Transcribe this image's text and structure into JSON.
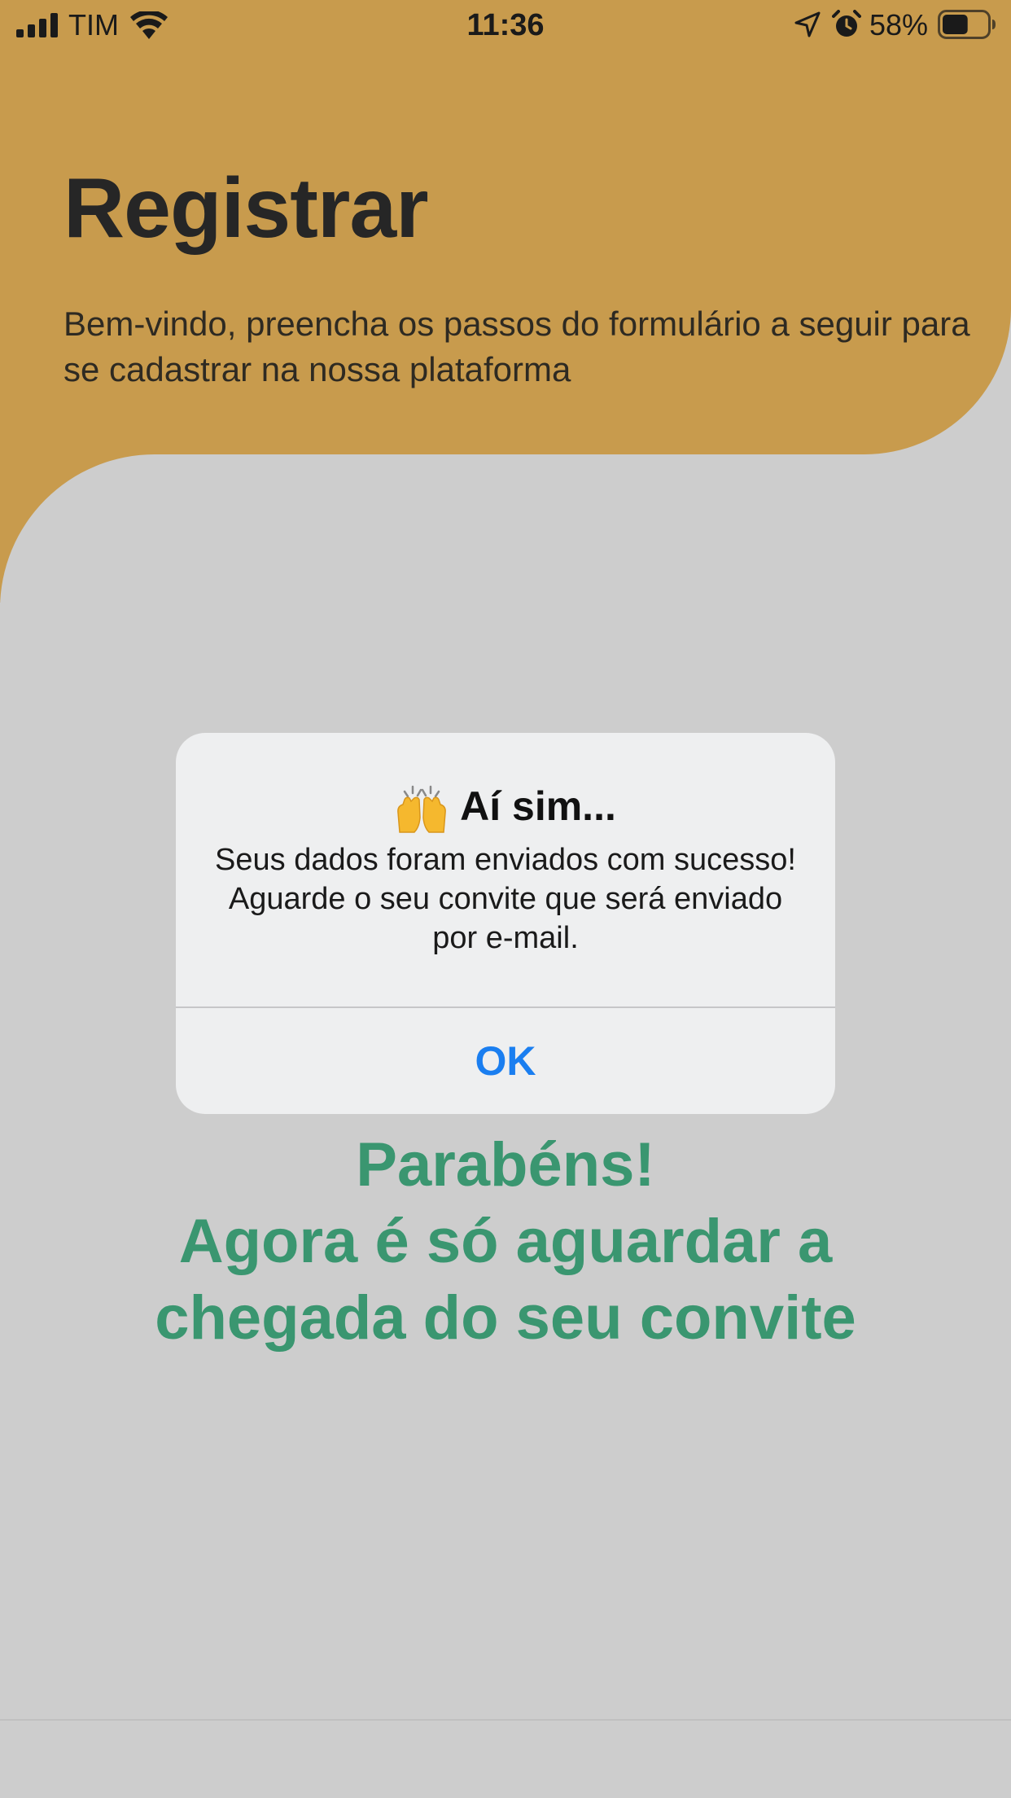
{
  "status_bar": {
    "carrier": "TIM",
    "time": "11:36",
    "battery_percent": "58%",
    "battery_level": 0.58,
    "icons": [
      "signal-icon",
      "wifi-icon",
      "location-icon",
      "alarm-icon",
      "battery-icon"
    ]
  },
  "header": {
    "title": "Registrar",
    "subtitle": "Bem-vindo, preencha os passos do formulário a seguir para se cadastrar na nossa plataforma"
  },
  "success": {
    "lines": [
      "Parabéns!",
      "Agora é só aguardar a",
      "chegada do seu convite"
    ]
  },
  "alert": {
    "emoji_icon": "raising-hands-icon",
    "title": "Aí sim...",
    "message": "Seus dados foram enviados com sucesso! Aguarde o seu convite que será enviado por e-mail.",
    "ok_label": "OK"
  },
  "colors": {
    "header_bg": "#c89b4d",
    "page_bg": "#cdcdcd",
    "success_text": "#3a9670",
    "alert_button": "#1a7ef0"
  }
}
